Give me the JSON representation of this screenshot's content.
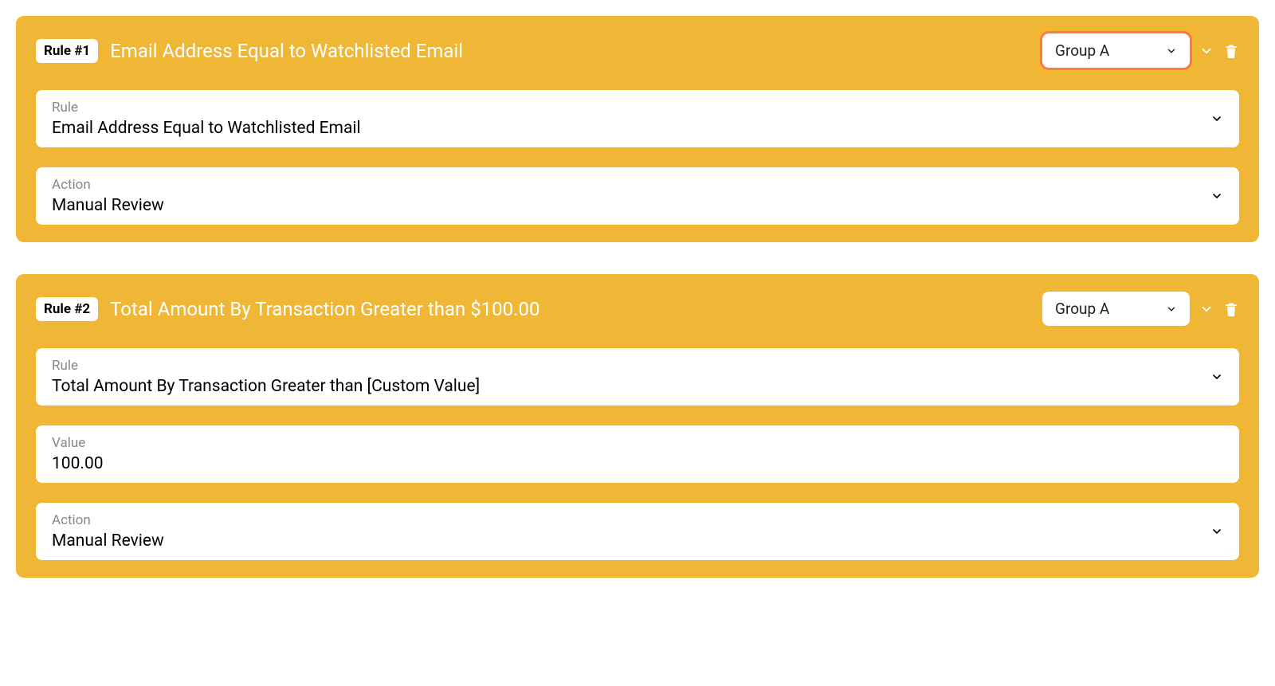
{
  "rules": [
    {
      "badge": "Rule #1",
      "title": "Email Address Equal to Watchlisted Email",
      "group": "Group A",
      "group_highlighted": true,
      "fields": [
        {
          "label": "Rule",
          "value": "Email Address Equal to Watchlisted Email",
          "type": "select"
        },
        {
          "label": "Action",
          "value": "Manual Review",
          "type": "select"
        }
      ]
    },
    {
      "badge": "Rule #2",
      "title": "Total Amount By Transaction Greater than $100.00",
      "group": "Group A",
      "group_highlighted": false,
      "fields": [
        {
          "label": "Rule",
          "value": "Total Amount By Transaction Greater than [Custom Value]",
          "type": "select"
        },
        {
          "label": "Value",
          "value": "100.00",
          "type": "input"
        },
        {
          "label": "Action",
          "value": "Manual Review",
          "type": "select"
        }
      ]
    }
  ]
}
